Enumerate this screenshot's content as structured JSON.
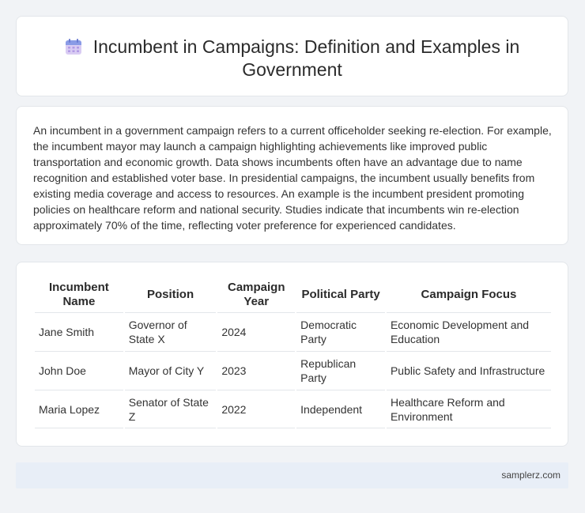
{
  "header": {
    "icon": "calendar-icon",
    "title": "Incumbent in Campaigns: Definition and Examples in Government"
  },
  "description": "An incumbent in a government campaign refers to a current officeholder seeking re-election. For example, the incumbent mayor may launch a campaign highlighting achievements like improved public transportation and economic growth. Data shows incumbents often have an advantage due to name recognition and established voter base. In presidential campaigns, the incumbent usually benefits from existing media coverage and access to resources. An example is the incumbent president promoting policies on healthcare reform and national security. Studies indicate that incumbents win re-election approximately 70% of the time, reflecting voter preference for experienced candidates.",
  "table": {
    "headers": [
      "Incumbent Name",
      "Position",
      "Campaign Year",
      "Political Party",
      "Campaign Focus"
    ],
    "rows": [
      [
        "Jane Smith",
        "Governor of State X",
        "2024",
        "Democratic Party",
        "Economic Development and Education"
      ],
      [
        "John Doe",
        "Mayor of City Y",
        "2023",
        "Republican Party",
        "Public Safety and Infrastructure"
      ],
      [
        "Maria Lopez",
        "Senator of State Z",
        "2022",
        "Independent",
        "Healthcare Reform and Environment"
      ]
    ]
  },
  "footer": {
    "site": "samplerz.com"
  },
  "colors": {
    "background": "#f1f3f6",
    "card": "#ffffff",
    "footer": "#e8eef7",
    "icon_top": "#7b8fe0",
    "icon_body": "#c9b8ee"
  }
}
